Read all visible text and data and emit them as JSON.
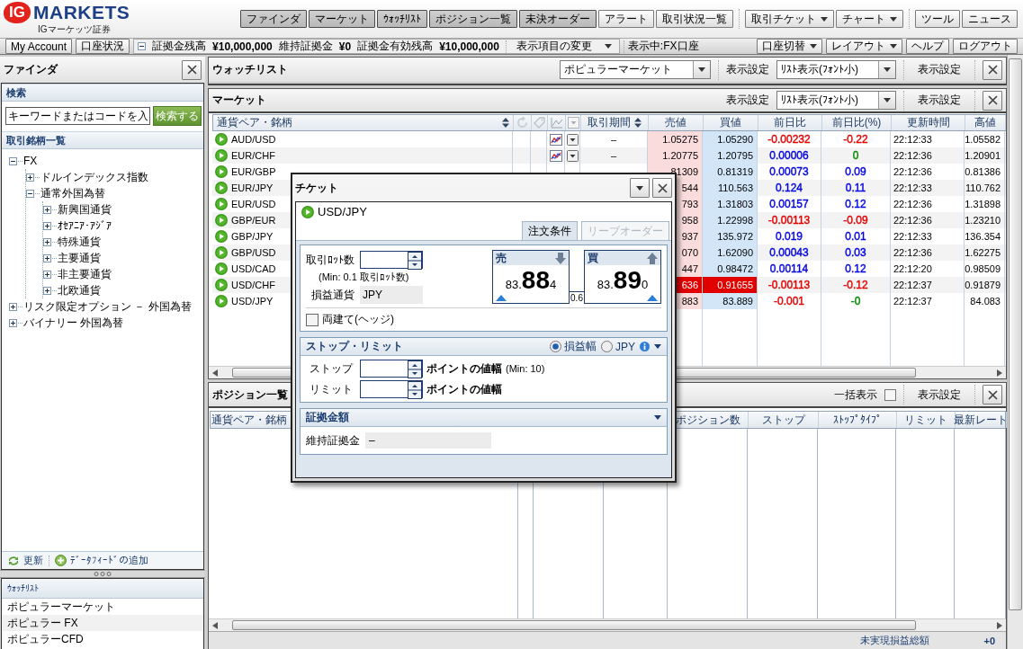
{
  "header": {
    "brand": {
      "badge": "IG",
      "name": "MARKETS",
      "subtitle": "IGマーケッツ証券"
    },
    "nav_groups": [
      [
        {
          "label": "ファインダ",
          "selected": true,
          "menu": false
        },
        {
          "label": "マーケット",
          "selected": true,
          "menu": false
        },
        {
          "label": "ｳｫｯﾁﾘｽﾄ",
          "selected": true,
          "menu": false
        },
        {
          "label": "ポジション一覧",
          "selected": true,
          "menu": false
        },
        {
          "label": "未決オーダー",
          "selected": true,
          "menu": false
        },
        {
          "label": "アラート",
          "selected": false,
          "menu": false
        },
        {
          "label": "取引状況一覧",
          "selected": false,
          "menu": false
        }
      ],
      [
        {
          "label": "取引チケット",
          "selected": false,
          "menu": true
        },
        {
          "label": "チャート",
          "selected": false,
          "menu": true
        }
      ],
      [
        {
          "label": "ツール",
          "selected": false,
          "menu": false
        },
        {
          "label": "ニュース",
          "selected": false,
          "menu": false
        }
      ]
    ]
  },
  "account_bar": {
    "buttons": [
      "My Account",
      "口座状況"
    ],
    "summary": [
      {
        "label": "証拠金残高",
        "value": "¥10,000,000"
      },
      {
        "label": "維持証拠金",
        "value": "¥0"
      },
      {
        "label": "証拠金有効残高",
        "value": "¥10,000,000"
      }
    ],
    "display_menu": "表示項目の変更",
    "account": "表示中:FX口座",
    "right_buttons": [
      {
        "label": "口座切替",
        "menu": true
      },
      {
        "label": "レイアウト",
        "menu": true
      },
      {
        "label": "ヘルプ",
        "menu": false
      },
      {
        "label": "ログアウト",
        "menu": false
      }
    ]
  },
  "finder": {
    "title": "ファインダ",
    "search_heading": "検索",
    "search_placeholder": "キーワードまたはコードを入",
    "search_button": "検索する",
    "tree_heading": "取引銘柄一覧",
    "tree": [
      {
        "label": "FX",
        "expanded": true,
        "children": [
          {
            "label": "ドルインデックス指数",
            "expanded": false
          },
          {
            "label": "通常外国為替",
            "expanded": true,
            "children": [
              {
                "label": "新興国通貨",
                "expanded": false
              },
              {
                "label": "ｵｾｱﾆｱ･ｱｼﾞｱ",
                "expanded": false
              },
              {
                "label": "特殊通貨",
                "expanded": false
              },
              {
                "label": "主要通貨",
                "expanded": false
              },
              {
                "label": "非主要通貨",
                "expanded": false
              },
              {
                "label": "北欧通貨",
                "expanded": false
              }
            ]
          }
        ]
      },
      {
        "label": "リスク限定オプション － 外国為替",
        "expanded": false
      },
      {
        "label": "バイナリー 外国為替",
        "expanded": false
      }
    ],
    "toolbar": [
      "更新",
      "ﾃﾞｰﾀﾌｨｰﾄﾞの追加"
    ],
    "watchlists_heading": "ｳｫｯﾁﾘｽﾄ",
    "watchlists": [
      "ポピュラーマーケット",
      "ポピュラー FX",
      "ポピュラーCFD"
    ]
  },
  "watchlist": {
    "title": "ウォッチリスト",
    "list": "ポピュラーマーケット",
    "view_label": "表示設定",
    "view": "ﾘｽﾄ表示(ﾌｫﾝﾄ小)",
    "settings": "表示設定"
  },
  "market": {
    "title": "マーケット",
    "view_label": "表示設定",
    "view": "ﾘｽﾄ表示(ﾌｫﾝﾄ小)",
    "settings": "表示設定",
    "columns": [
      {
        "label": "通貨ペア・銘柄",
        "sortable": true
      },
      {
        "label": "取引期間",
        "sortable": true
      },
      {
        "label": "売値",
        "sortable": false
      },
      {
        "label": "買値",
        "sortable": false
      },
      {
        "label": "前日比",
        "sortable": false
      },
      {
        "label": "前日比(%)",
        "sortable": false
      },
      {
        "label": "更新時間",
        "sortable": false
      },
      {
        "label": "高値",
        "sortable": false
      }
    ],
    "rows": [
      {
        "name": "AUD/USD",
        "tools": true,
        "period": "–",
        "bid": "1.05275",
        "offer": "1.05290",
        "flash": false,
        "change": {
          "text": "-0.00232",
          "color": "#e00000"
        },
        "change_pct": {
          "text": "-0.22",
          "color": "#e00000"
        },
        "time": "22:12:33",
        "high": "1.05582"
      },
      {
        "name": "EUR/CHF",
        "tools": true,
        "period": "–",
        "bid": "1.20775",
        "offer": "1.20795",
        "flash": false,
        "change": {
          "text": "0.00006",
          "color": "#0000e0"
        },
        "change_pct": {
          "text": "0",
          "color": "#008a00"
        },
        "time": "22:12:36",
        "high": "1.20901"
      },
      {
        "name": "EUR/GBP",
        "tools": false,
        "bid": "81309",
        "offer": "0.81319",
        "flash": false,
        "change": {
          "text": "0.00073",
          "color": "#0000e0"
        },
        "change_pct": {
          "text": "0.09",
          "color": "#0000e0"
        },
        "time": "22:12:36",
        "high": "0.81386"
      },
      {
        "name": "EUR/JPY",
        "tools": false,
        "bid": "544",
        "offer": "110.563",
        "flash": false,
        "change": {
          "text": "0.124",
          "color": "#0000e0"
        },
        "change_pct": {
          "text": "0.11",
          "color": "#0000e0"
        },
        "time": "22:12:33",
        "high": "110.762"
      },
      {
        "name": "EUR/USD",
        "tools": false,
        "bid": "793",
        "offer": "1.31803",
        "flash": false,
        "change": {
          "text": "0.00157",
          "color": "#0000e0"
        },
        "change_pct": {
          "text": "0.12",
          "color": "#0000e0"
        },
        "time": "22:12:36",
        "high": "1.31898"
      },
      {
        "name": "GBP/EUR",
        "tools": false,
        "bid": "958",
        "offer": "1.22998",
        "flash": false,
        "change": {
          "text": "-0.00113",
          "color": "#e00000"
        },
        "change_pct": {
          "text": "-0.09",
          "color": "#e00000"
        },
        "time": "22:12:36",
        "high": "1.23210"
      },
      {
        "name": "GBP/JPY",
        "tools": false,
        "bid": "937",
        "offer": "135.972",
        "flash": false,
        "change": {
          "text": "0.019",
          "color": "#0000e0"
        },
        "change_pct": {
          "text": "0.01",
          "color": "#0000e0"
        },
        "time": "22:12:33",
        "high": "136.354"
      },
      {
        "name": "GBP/USD",
        "tools": false,
        "bid": "070",
        "offer": "1.62090",
        "flash": false,
        "change": {
          "text": "0.00043",
          "color": "#0000e0"
        },
        "change_pct": {
          "text": "0.03",
          "color": "#0000e0"
        },
        "time": "22:12:36",
        "high": "1.62275"
      },
      {
        "name": "USD/CAD",
        "tools": false,
        "bid": "447",
        "offer": "0.98472",
        "flash": false,
        "change": {
          "text": "0.00114",
          "color": "#0000e0"
        },
        "change_pct": {
          "text": "0.12",
          "color": "#0000e0"
        },
        "time": "22:12:20",
        "high": "0.98509"
      },
      {
        "name": "USD/CHF",
        "tools": false,
        "bid": "636",
        "offer": "0.91655",
        "flash": true,
        "change": {
          "text": "-0.00113",
          "color": "#e00000"
        },
        "change_pct": {
          "text": "-0.12",
          "color": "#e00000"
        },
        "time": "22:12:37",
        "high": "0.91879"
      },
      {
        "name": "USD/JPY",
        "tools": false,
        "bid": "883",
        "offer": "83.889",
        "flash": false,
        "change": {
          "text": "-0.001",
          "color": "#e00000"
        },
        "change_pct": {
          "text": "-0",
          "color": "#008a00"
        },
        "time": "22:12:37",
        "high": "84.083"
      }
    ]
  },
  "positions": {
    "title": "ポジション一覧",
    "show_all": "一括表示",
    "show_all_checked": false,
    "settings": "表示設定",
    "columns": [
      "通貨ペア・銘柄",
      "ポジション数",
      "ストップ",
      "ｽﾄｯﾌﾟﾀｲﾌﾟ",
      "リミット",
      "最新レート"
    ],
    "total_label": "未実現損益総額",
    "total": "+0"
  },
  "ticket": {
    "title": "チケット",
    "instrument": "USD/JPY",
    "tabs": [
      {
        "label": "注文条件",
        "selected": true,
        "disabled": false
      },
      {
        "label": "リーブオーダー",
        "selected": false,
        "disabled": true
      }
    ],
    "lot_label": "取引ﾛｯﾄ数",
    "lot_note": "(Min: 0.1 取引ﾛｯﾄ数)",
    "currency_label": "損益通貨",
    "currency": "JPY",
    "prices": [
      {
        "side": "売",
        "kind": "sell",
        "prefix": "83.",
        "big": "88",
        "small": "4"
      },
      {
        "side": "買",
        "kind": "buy",
        "prefix": "83.",
        "big": "89",
        "small": "0"
      }
    ],
    "spread": "0.6",
    "hedge": {
      "label": "両建て(ヘッジ)",
      "checked": false
    },
    "stop_limit": {
      "title": "ストップ・リミット",
      "units": [
        {
          "label": "損益幅",
          "selected": true
        },
        {
          "label": "JPY",
          "selected": false
        }
      ],
      "rows": [
        {
          "label": "ストップ",
          "unit": "ポイントの値幅",
          "note": "(Min: 10)"
        },
        {
          "label": "リミット",
          "unit": "ポイントの値幅"
        }
      ]
    },
    "margin": {
      "title": "証拠金額",
      "label": "維持証拠金",
      "value": "–"
    }
  }
}
